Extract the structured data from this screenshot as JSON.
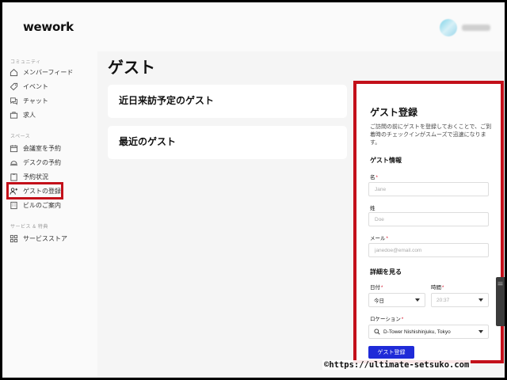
{
  "header": {
    "logo": "wework"
  },
  "sidebar": {
    "section_community": "コミュニティ",
    "section_space": "スペース",
    "section_service": "サービス & 特典",
    "items": [
      {
        "label": "メンバーフィード",
        "icon": "house-icon"
      },
      {
        "label": "イベント",
        "icon": "tag-icon"
      },
      {
        "label": "チャット",
        "icon": "chat-icon"
      },
      {
        "label": "求人",
        "icon": "briefcase-icon"
      },
      {
        "label": "会議室を予約",
        "icon": "calendar-icon"
      },
      {
        "label": "デスクの予約",
        "icon": "desk-icon"
      },
      {
        "label": "予約状況",
        "icon": "clipboard-icon"
      },
      {
        "label": "ゲストの登録",
        "icon": "person-add-icon",
        "active": true
      },
      {
        "label": "ビルのご案内",
        "icon": "building-icon"
      },
      {
        "label": "サービスストア",
        "icon": "grid-icon"
      }
    ]
  },
  "main": {
    "title": "ゲスト",
    "cards": [
      "近日来訪予定のゲスト",
      "最近のゲスト"
    ]
  },
  "panel": {
    "title": "ゲスト登録",
    "description": "ご訪問の前にゲストを登録しておくことで、ご到着時のチェックインがスムーズで迅速になります。",
    "guest_info_heading": "ゲスト情報",
    "first_name_label": "名",
    "first_name_placeholder": "Jane",
    "last_name_label": "姓",
    "last_name_placeholder": "Doe",
    "email_label": "メール",
    "email_placeholder": "janedoe@email.com",
    "details_heading": "詳細を見る",
    "date_label": "日付",
    "date_value": "今日",
    "time_label": "時間",
    "time_value": "20:37",
    "location_label": "ロケーション",
    "location_value": "D-Tower Nishishinjuku, Tokyo",
    "submit_label": "ゲスト登録",
    "required_mark": "*"
  },
  "watermark": "©https://ultimate-setsuko.com",
  "colors": {
    "highlight": "#c3101a",
    "button": "#1f2bd8"
  }
}
